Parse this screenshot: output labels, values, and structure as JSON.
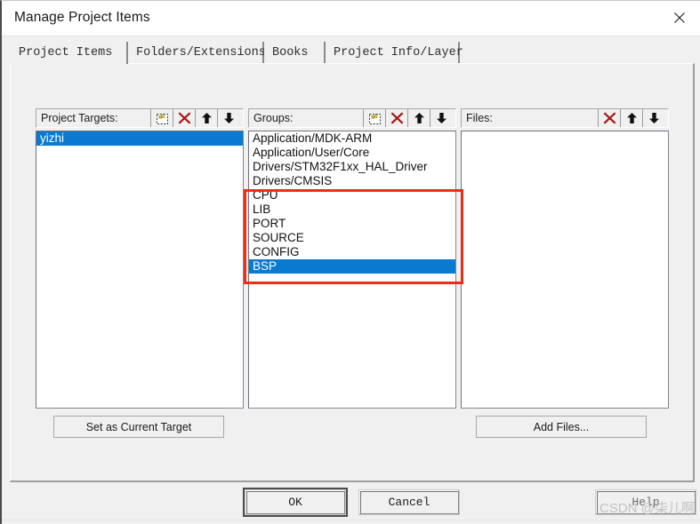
{
  "window": {
    "title": "Manage Project Items",
    "close_icon": "close-icon"
  },
  "tabs": [
    {
      "label": "Project Items",
      "active": true
    },
    {
      "label": "Folders/Extensions",
      "active": false
    },
    {
      "label": "Books",
      "active": false
    },
    {
      "label": "Project Info/Layer",
      "active": false
    }
  ],
  "panels": {
    "targets": {
      "title": "Project Targets:",
      "icons": [
        "new-item-icon",
        "delete-icon",
        "move-up-icon",
        "move-down-icon"
      ],
      "items": [
        {
          "label": "yizhi",
          "selected": true
        }
      ],
      "button": "Set as Current Target"
    },
    "groups": {
      "title": "Groups:",
      "icons": [
        "new-item-icon",
        "delete-icon",
        "move-up-icon",
        "move-down-icon"
      ],
      "items": [
        {
          "label": "Application/MDK-ARM",
          "selected": false
        },
        {
          "label": "Application/User/Core",
          "selected": false
        },
        {
          "label": "Drivers/STM32F1xx_HAL_Driver",
          "selected": false
        },
        {
          "label": "Drivers/CMSIS",
          "selected": false
        },
        {
          "label": "CPU",
          "selected": false
        },
        {
          "label": "LIB",
          "selected": false
        },
        {
          "label": "PORT",
          "selected": false
        },
        {
          "label": "SOURCE",
          "selected": false
        },
        {
          "label": "CONFIG",
          "selected": false
        },
        {
          "label": "BSP",
          "selected": true
        }
      ]
    },
    "files": {
      "title": "Files:",
      "icons": [
        "delete-icon",
        "move-up-icon",
        "move-down-icon"
      ],
      "items": [],
      "button": "Add Files..."
    }
  },
  "footer": {
    "ok": "OK",
    "cancel": "Cancel",
    "help": "Help"
  },
  "annotation": {
    "color": "#ef2d16"
  },
  "watermark": {
    "text": "CSDN @柒儿啊"
  },
  "colors": {
    "selection": "#0a7ad1",
    "dialog_bg": "#f0f0f0",
    "annotation": "#ef2d16"
  }
}
